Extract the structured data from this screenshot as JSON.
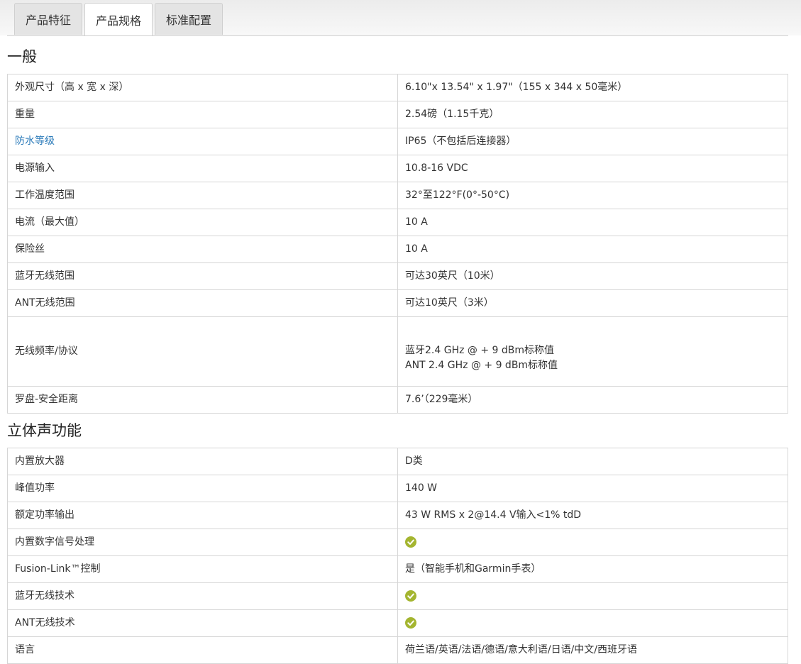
{
  "tabs": [
    {
      "label": "产品特征",
      "active": false
    },
    {
      "label": "产品规格",
      "active": true
    },
    {
      "label": "标准配置",
      "active": false
    }
  ],
  "colors": {
    "link": "#2a7ab9",
    "check": "#a4b530",
    "border": "#d6d6d6"
  },
  "sections": [
    {
      "title": "一般",
      "rows": [
        {
          "label": "外观尺寸（高 x 宽 x 深）",
          "value": "6.10\"x 13.54\" x 1.97\"（155 x 344 x 50毫米）"
        },
        {
          "label": "重量",
          "value": "2.54磅（1.15千克）"
        },
        {
          "label": "防水等级",
          "value": "IP65（不包括后连接器）",
          "label_is_link": true
        },
        {
          "label": "电源输入",
          "value": "10.8-16 VDC"
        },
        {
          "label": "工作温度范围",
          "value": "32°至122°F(0°-50°C)"
        },
        {
          "label": "电流（最大值）",
          "value": "10 A"
        },
        {
          "label": "保险丝",
          "value": "10 A"
        },
        {
          "label": "蓝牙无线范围",
          "value": "可达30英尺（10米）"
        },
        {
          "label": "ANT无线范围",
          "value": "可达10英尺（3米）"
        },
        {
          "label": "无线频率/协议",
          "value_lines": [
            "蓝牙2.4 GHz @ + 9 dBm标称值",
            "ANT 2.4 GHz @ + 9 dBm标称值"
          ]
        },
        {
          "label": "罗盘-安全距离",
          "value": "7.6’（229毫米）"
        }
      ]
    },
    {
      "title": "立体声功能",
      "rows": [
        {
          "label": "内置放大器",
          "value": "D类"
        },
        {
          "label": "峰值功率",
          "value": "140 W"
        },
        {
          "label": "额定功率输出",
          "value": "43 W RMS x 2@14.4 V输入<1% tdD"
        },
        {
          "label": "内置数字信号处理",
          "icon": "check-circle-icon"
        },
        {
          "label": "Fusion-Link™控制",
          "value": "是（智能手机和Garmin手表）"
        },
        {
          "label": "蓝牙无线技术",
          "icon": "check-circle-icon"
        },
        {
          "label": "ANT无线技术",
          "icon": "check-circle-icon"
        },
        {
          "label": "语言",
          "value": "荷兰语/英语/法语/德语/意大利语/日语/中文/西班牙语"
        }
      ]
    }
  ]
}
